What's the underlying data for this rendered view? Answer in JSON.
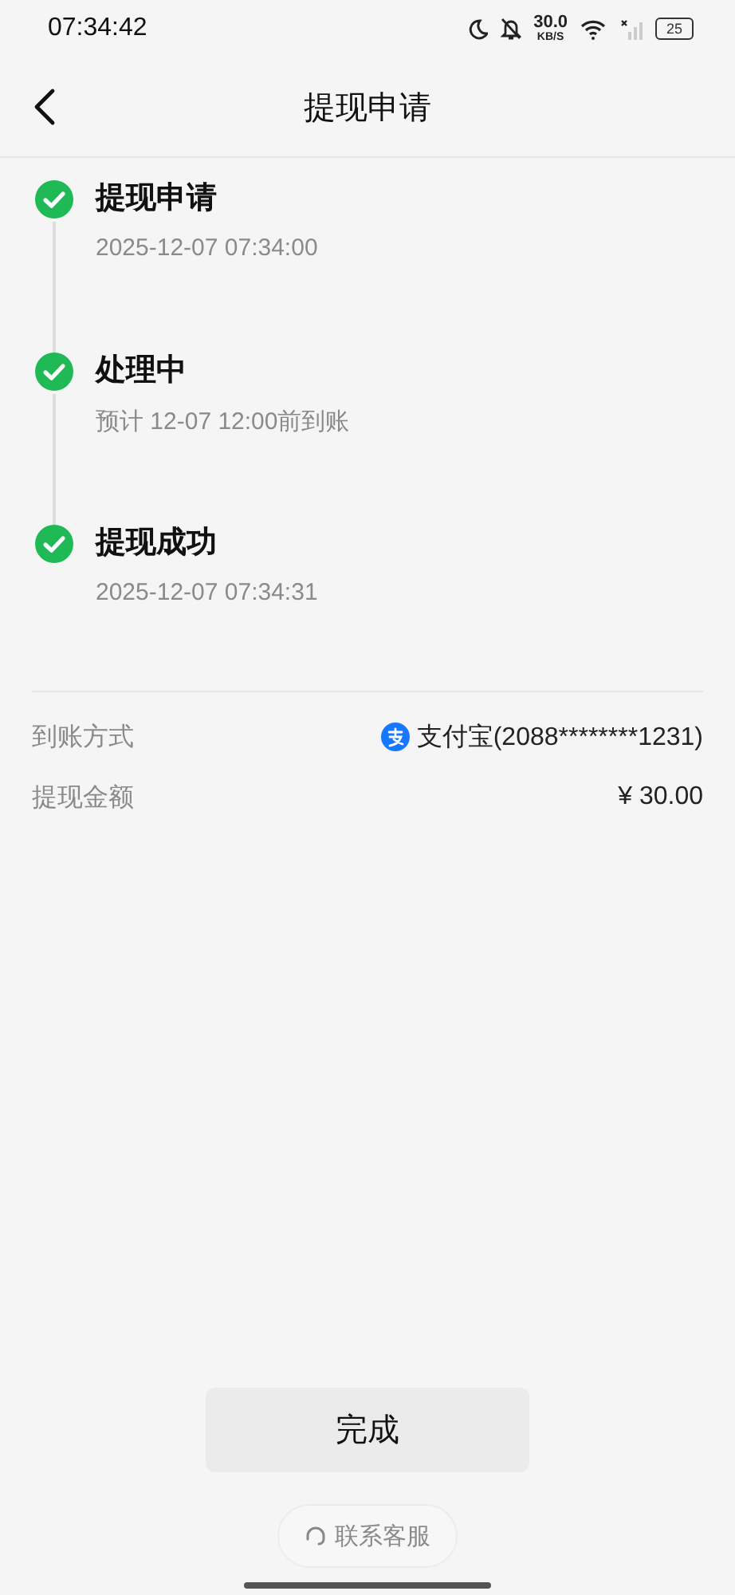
{
  "status_bar": {
    "time": "07:34:42",
    "speed": "30.0",
    "speed_unit": "KB/S",
    "battery": "25"
  },
  "header": {
    "title": "提现申请"
  },
  "steps": [
    {
      "title": "提现申请",
      "subtitle": "2025-12-07 07:34:00",
      "done": true
    },
    {
      "title": "处理中",
      "subtitle": "预计 12-07 12:00前到账",
      "done": true
    },
    {
      "title": "提现成功",
      "subtitle": "2025-12-07 07:34:31",
      "done": true
    }
  ],
  "details": [
    {
      "label": "到账方式",
      "value": "支付宝(2088********1231)",
      "kind": "alipay"
    },
    {
      "label": "提现金额",
      "value": "¥ 30.00",
      "kind": "plain"
    }
  ],
  "done_button": "完成",
  "contact_button": "联系客服"
}
